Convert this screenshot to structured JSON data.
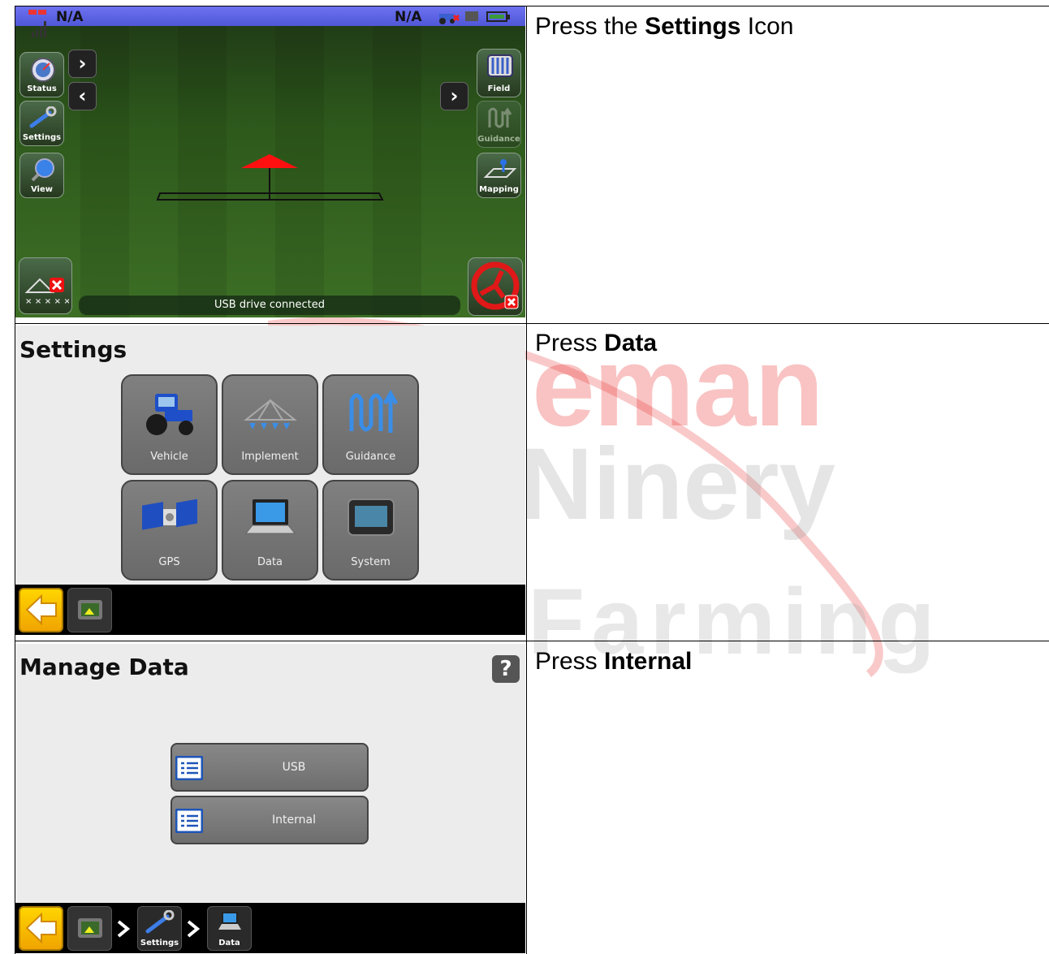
{
  "rows": [
    {
      "instruction_prefix": "Press the ",
      "instruction_bold": "Settings",
      "instruction_suffix": " Icon",
      "screen": {
        "status_left": "N/A",
        "status_right": "N/A",
        "left_buttons": [
          "Status",
          "Settings",
          "View"
        ],
        "right_buttons": [
          "Field",
          "Guidance",
          "Mapping"
        ],
        "status_message": "USB drive connected",
        "nav_forward": "›",
        "nav_back": "‹"
      }
    },
    {
      "instruction_prefix": "Press ",
      "instruction_bold": "Data",
      "instruction_suffix": "",
      "screen": {
        "title": "Settings",
        "tiles": [
          "Vehicle",
          "Implement",
          "Guidance",
          "GPS",
          "Data",
          "System"
        ]
      }
    },
    {
      "instruction_prefix": "Press ",
      "instruction_bold": "Internal",
      "instruction_suffix": "",
      "screen": {
        "title": "Manage Data",
        "help_label": "?",
        "options": [
          "USB",
          "Internal"
        ],
        "breadcrumb": [
          "Settings",
          "Data"
        ]
      }
    }
  ],
  "watermark": {
    "line1": "eman",
    "line2": "Ninery",
    "line3": "Farming"
  },
  "colors": {
    "status_bar": "#5a60e0",
    "field_green": "#2e5a1c",
    "back_button": "#f5b800",
    "watermark_red": "#e82828"
  }
}
